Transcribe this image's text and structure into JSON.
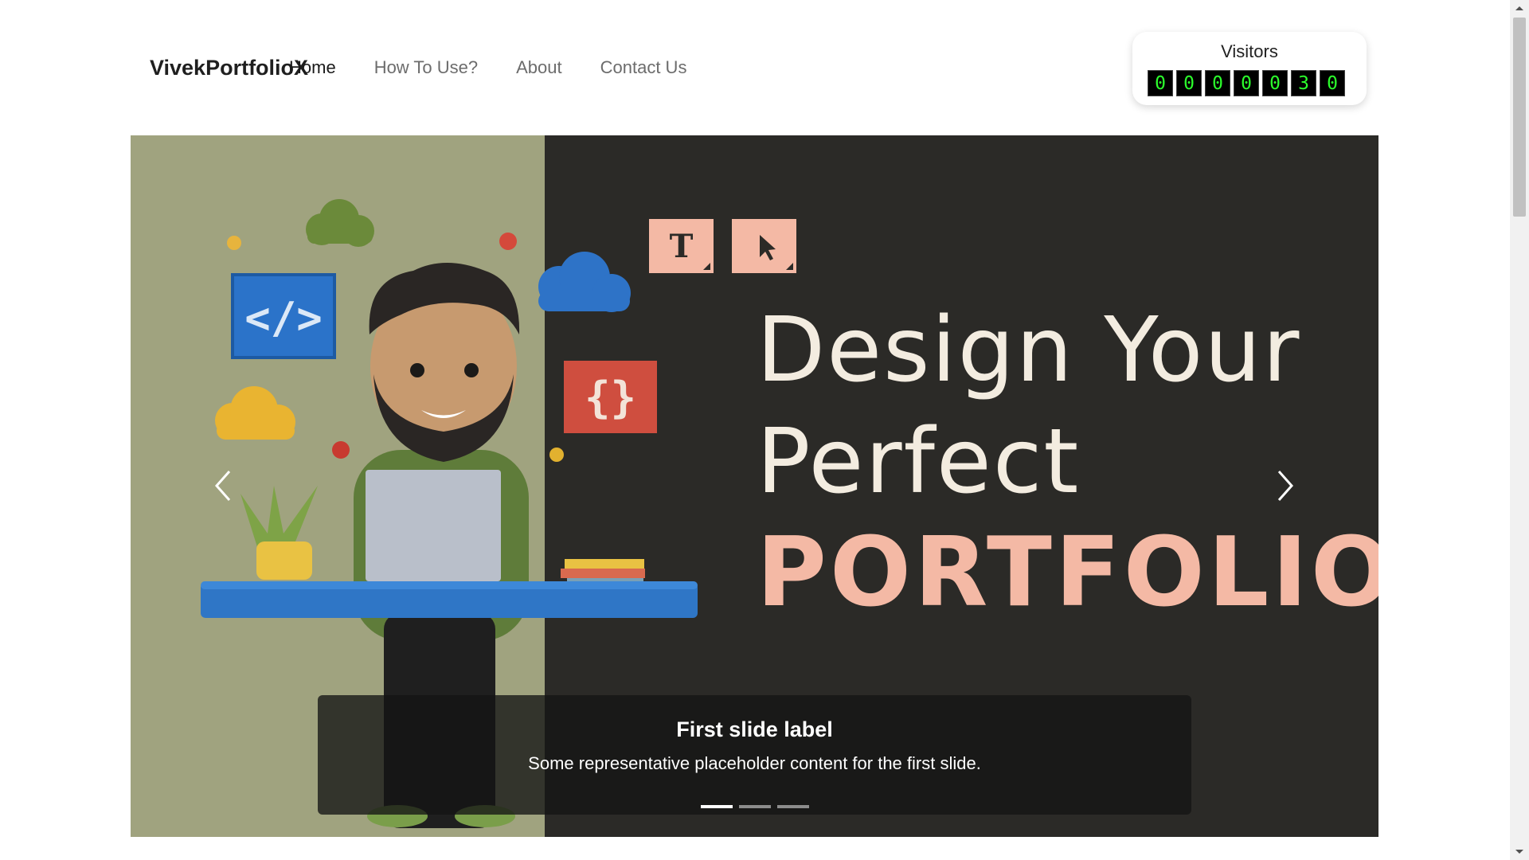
{
  "navbar": {
    "brand": "VivekPortfolioX",
    "links": [
      {
        "label": "Home",
        "active": true
      },
      {
        "label": "How To Use?",
        "active": false
      },
      {
        "label": "About",
        "active": false
      },
      {
        "label": "Contact Us",
        "active": false
      }
    ]
  },
  "visitors": {
    "title": "Visitors",
    "digits": [
      "0",
      "0",
      "0",
      "0",
      "0",
      "3",
      "0"
    ]
  },
  "carousel": {
    "hero": {
      "line1": "Design Your",
      "line2": "Perfect",
      "line3": "PORTFOLIO"
    },
    "tool_icons": [
      "T",
      "cursor-arrow"
    ],
    "code_icons": [
      "</>",
      "{}"
    ],
    "caption": {
      "title": "First slide label",
      "text": "Some representative placeholder content for the first slide."
    },
    "indicators": 3,
    "active_indicator": 0,
    "colors": {
      "left_panel": "#a0a37f",
      "right_panel": "#2b2a27",
      "accent_pink": "#f4b9a5",
      "hero_text": "#f3ece0"
    }
  },
  "icons": {
    "prev": "chevron-left-icon",
    "next": "chevron-right-icon"
  }
}
